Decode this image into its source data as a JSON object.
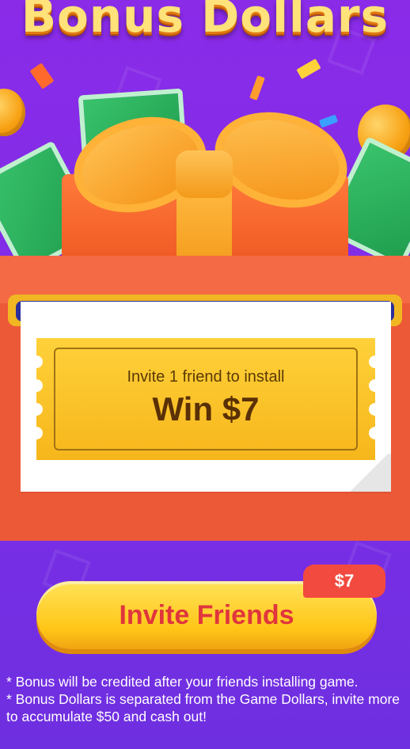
{
  "header": {
    "title": "Bonus Dollars"
  },
  "ticket": {
    "line1": "Invite 1 friend to install",
    "line2": "Win $7"
  },
  "cta": {
    "label": "Invite Friends",
    "badge": "$7"
  },
  "notes": [
    "* Bonus will be credited after your friends installing game.",
    "* Bonus Dollars is separated from the Game Dollars, invite more to accumulate $50 and cash out!"
  ],
  "colors": {
    "background": "#8a2be8",
    "envelope": "#ec5937",
    "ticket": "#ffd13a",
    "cta": "#ffc617",
    "cta_text": "#e0363c",
    "badge": "#f24a3f"
  },
  "icons": [
    "gift-box-icon",
    "coin-icon",
    "dollar-bill-icon",
    "confetti-icon"
  ]
}
